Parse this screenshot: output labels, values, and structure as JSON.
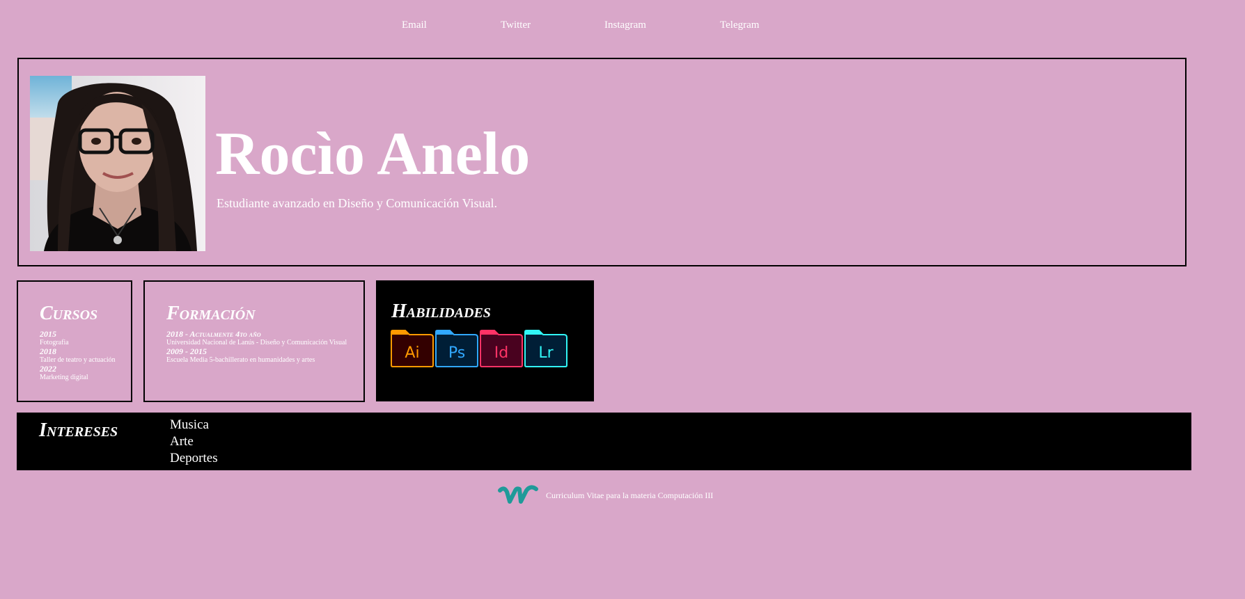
{
  "nav": {
    "links": [
      {
        "label": "Email"
      },
      {
        "label": "Twitter"
      },
      {
        "label": "Instagram"
      },
      {
        "label": "Telegram"
      }
    ]
  },
  "header": {
    "name": "Rocìo Anelo",
    "subtitle": "Estudiante avanzado en Diseño y Comunicación Visual."
  },
  "cursos": {
    "title": "Cursos",
    "entries": [
      {
        "year": "2015",
        "desc": "Fotografia"
      },
      {
        "year": "2018",
        "desc": "Taller de teatro y actuación"
      },
      {
        "year": "2022",
        "desc": "Marketing digital"
      }
    ]
  },
  "formacion": {
    "title": "Formación",
    "entries": [
      {
        "year": "2018 - Actualmente 4to año",
        "desc": "Universidad Nacional de Lanús - Diseño y Comunicación Visual"
      },
      {
        "year": "2009 - 2015",
        "desc": "Escuela Media 5-bachillerato en humanidades y artes"
      }
    ]
  },
  "habilidades": {
    "title": "Habilidades",
    "apps": [
      {
        "label": "Ai",
        "color": "#ff9a00",
        "bg": "#330000"
      },
      {
        "label": "Ps",
        "color": "#31a8ff",
        "bg": "#001e36"
      },
      {
        "label": "Id",
        "color": "#ff3366",
        "bg": "#49021f"
      },
      {
        "label": "Lr",
        "color": "#31f5f5",
        "bg": "#001e36"
      }
    ]
  },
  "intereses": {
    "title": "Intereses",
    "items": [
      "Musica",
      "Arte",
      "Deportes"
    ]
  },
  "footer": {
    "logo": "w",
    "text": "Curriculum Vitae para la materia Computación III"
  },
  "colors": {
    "background": "#d9a7c9",
    "text": "#ffffff",
    "dark": "#000000",
    "logo": "#1f9a99"
  }
}
